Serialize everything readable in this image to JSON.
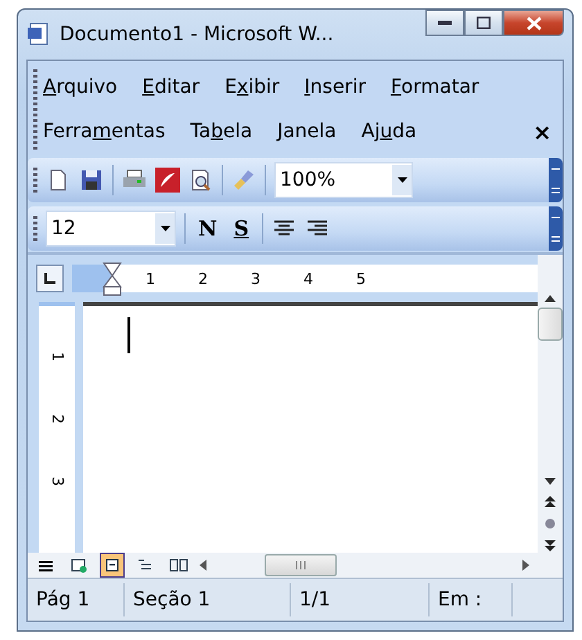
{
  "window": {
    "title": "Documento1 - Microsoft W..."
  },
  "menu_rows": [
    [
      {
        "key": "A",
        "after": "rquivo"
      },
      {
        "key": "E",
        "after": "ditar"
      },
      {
        "before": "E",
        "key": "x",
        "after": "ibir"
      },
      {
        "key": "I",
        "after": "nserir"
      },
      {
        "key": "F",
        "after": "ormatar"
      }
    ],
    [
      {
        "before": "Ferra",
        "key": "m",
        "after": "entas"
      },
      {
        "before": "Ta",
        "key": "b",
        "after": "ela"
      },
      {
        "key": "J",
        "after": "anela"
      },
      {
        "before": "Aj",
        "key": "u",
        "after": "da"
      }
    ]
  ],
  "menu_close": "×",
  "standard_toolbar": {
    "zoom": "100%"
  },
  "format_toolbar": {
    "font_size": "12",
    "bold": "N",
    "underline": "S"
  },
  "ruler": {
    "marks": [
      "1",
      "2",
      "3",
      "4",
      "5"
    ],
    "vertical_marks": [
      "1",
      "2",
      "3"
    ]
  },
  "view_buttons": [
    {
      "kind": "normal",
      "selected": false
    },
    {
      "kind": "web",
      "selected": false
    },
    {
      "kind": "print",
      "selected": true
    },
    {
      "kind": "outline",
      "selected": false
    },
    {
      "kind": "reading",
      "selected": false
    }
  ],
  "status_bar": [
    "Pág 1",
    "Seção 1",
    "1/1",
    "Em :"
  ]
}
